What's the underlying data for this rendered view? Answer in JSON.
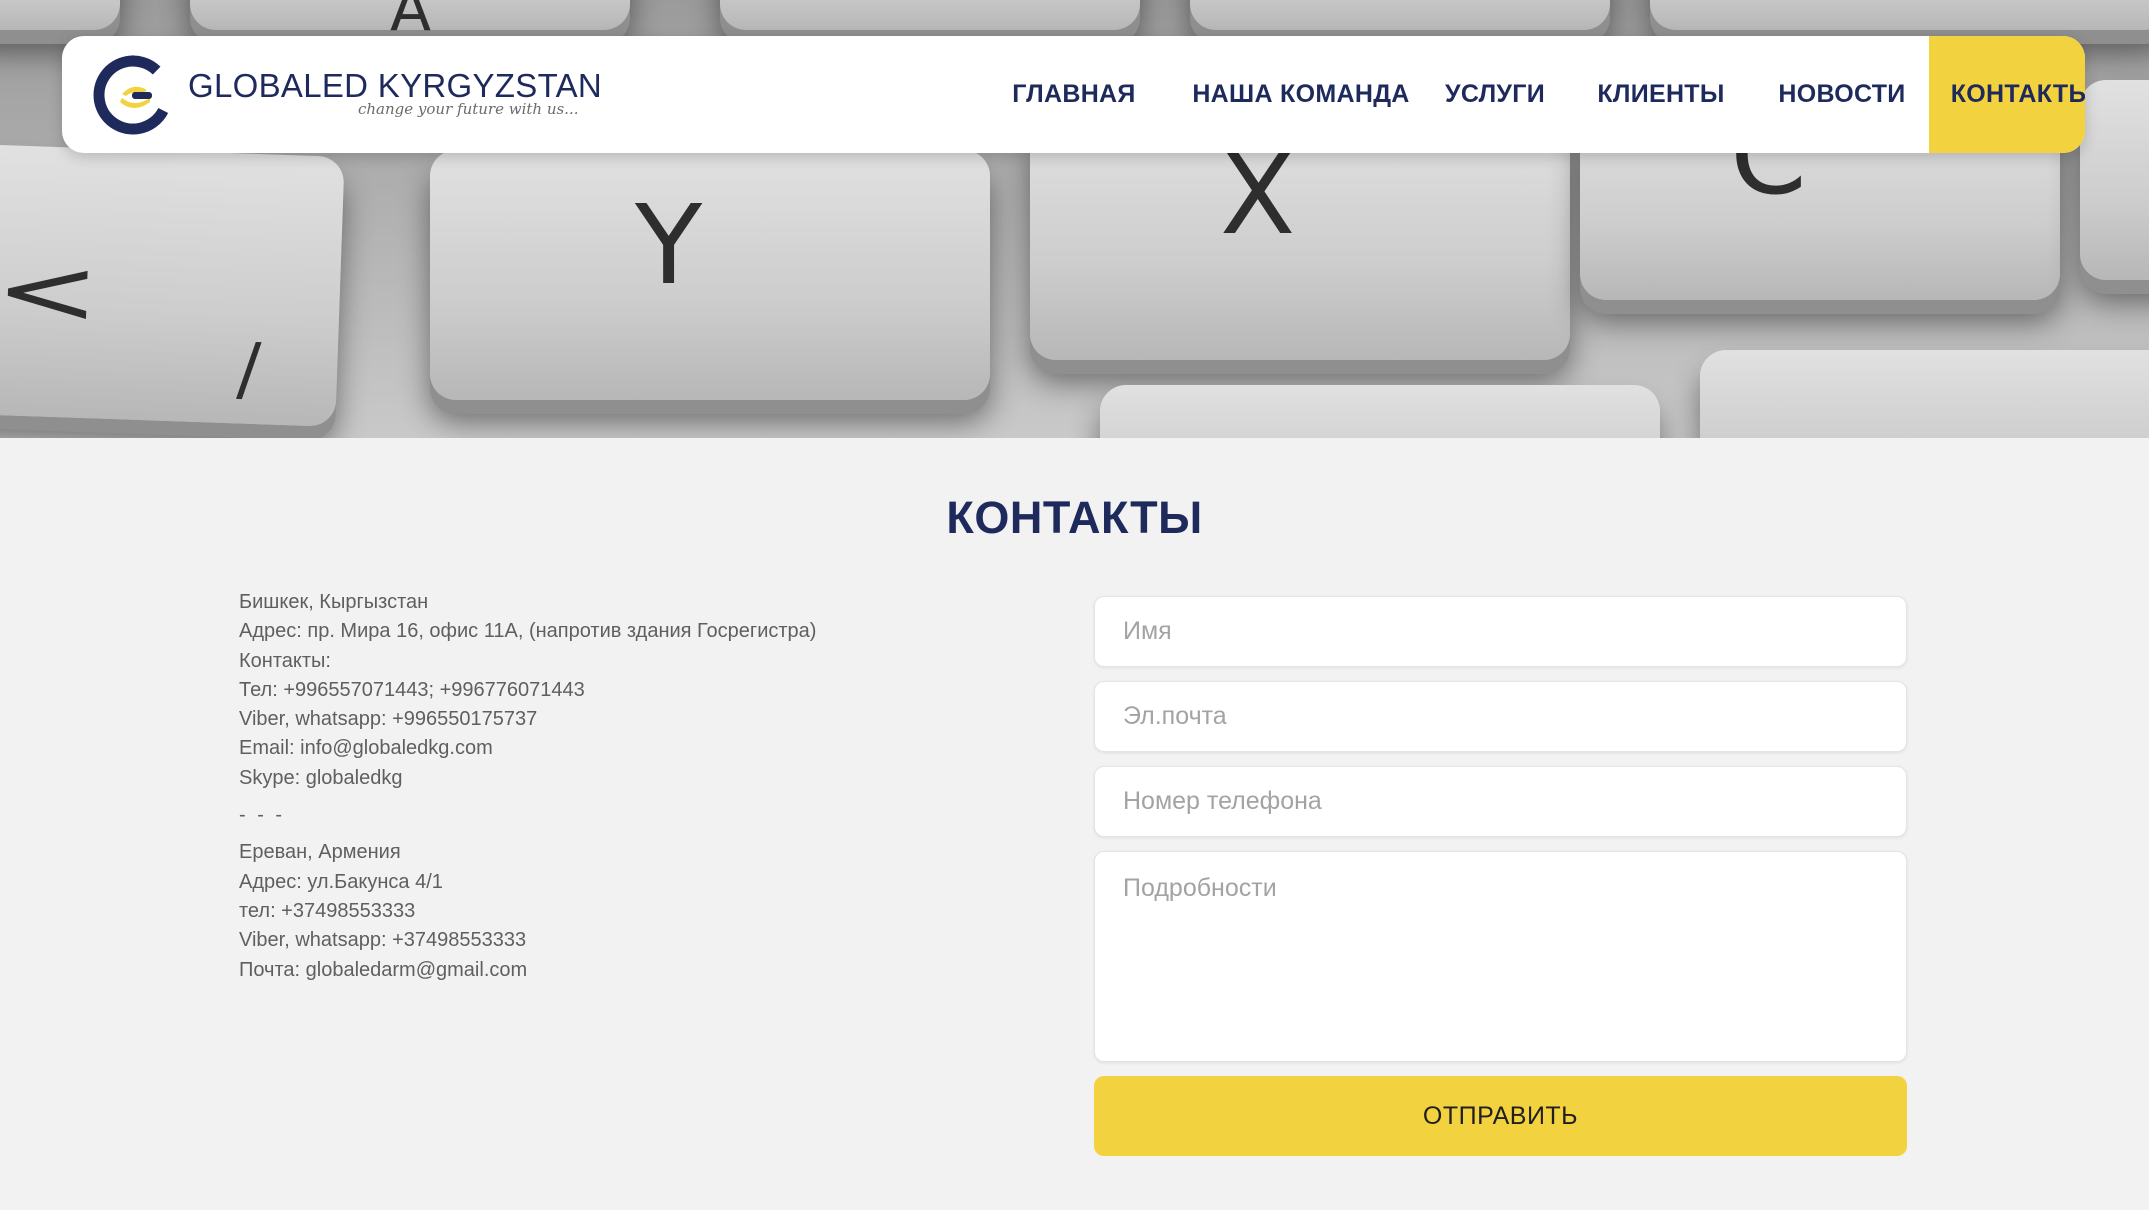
{
  "brand": {
    "name": "GLOBALED KYRGYZSTAN",
    "tagline": "change your future with us...",
    "primary_color": "#1e2a5c",
    "accent_color": "#f3d23f",
    "logo_icon": "globaled-logo-icon"
  },
  "hero": {
    "image": "keyboard-keys-photo",
    "key_glyphs": [
      "A",
      "<",
      "Y",
      "X",
      "C",
      "/"
    ]
  },
  "nav": {
    "items": [
      {
        "label": "ГЛАВНАЯ",
        "active": false
      },
      {
        "label": "НАША КОМАНДА",
        "active": false
      },
      {
        "label": "УСЛУГИ",
        "active": false
      },
      {
        "label": "КЛИЕНТЫ",
        "active": false
      },
      {
        "label": "НОВОСТИ",
        "active": false
      },
      {
        "label": "КОНТАКТЫ",
        "active": true
      }
    ]
  },
  "page": {
    "title": "КОНТАКТЫ"
  },
  "contacts": {
    "bishkek": [
      "Бишкек, Кыргызстан",
      "Адрес: пр. Мира 16, офис 11А, (напротив здания Госрегистра)",
      "Контакты:",
      "Тел: +996557071443; +996776071443",
      "Viber, whatsapp: +996550175737",
      "Email: info@globaledkg.com",
      "Skype: globaledkg"
    ],
    "separator": "- - -",
    "yerevan": [
      "Ереван, Армения",
      "Адрес: ул.Бакунса 4/1",
      "тел: +37498553333",
      "Viber, whatsapp: +37498553333",
      "Почта: globaledarm@gmail.com"
    ]
  },
  "form": {
    "name_placeholder": "Имя",
    "email_placeholder": "Эл.почта",
    "phone_placeholder": "Номер телефона",
    "details_placeholder": "Подробности",
    "name_value": "",
    "email_value": "",
    "phone_value": "",
    "details_value": "",
    "submit_label": "ОТПРАВИТЬ"
  }
}
